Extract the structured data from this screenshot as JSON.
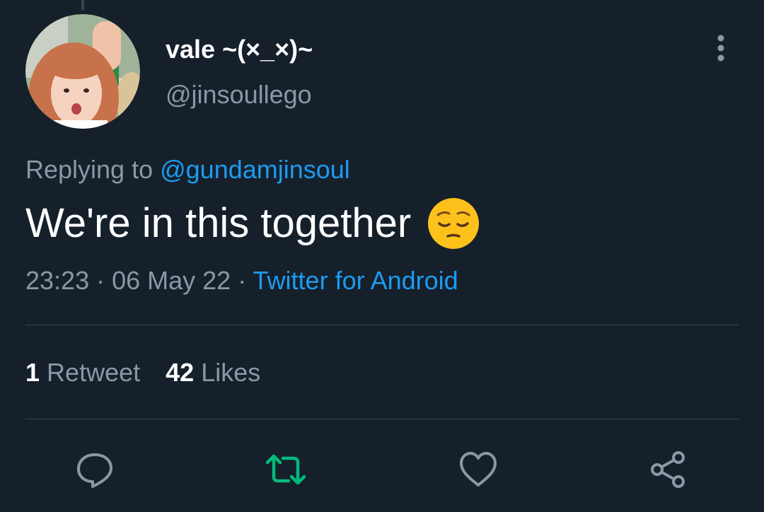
{
  "author": {
    "display_name": "vale ~(×_×)~",
    "handle": "@jinsoullego"
  },
  "tweet": {
    "replying_prefix": "Replying to ",
    "replying_to": "@gundamjinsoul",
    "text": "We're in this together",
    "emoji": "pensive-face",
    "time": "23:23",
    "separator": " · ",
    "date": "06 May 22",
    "source": "Twitter for Android"
  },
  "stats": {
    "retweet_count": "1",
    "retweet_label": "Retweet",
    "like_count": "42",
    "like_label": "Likes"
  },
  "actions": {
    "reply_icon": "reply-icon",
    "retweet_icon": "retweet-icon",
    "like_icon": "heart-icon",
    "share_icon": "share-icon"
  },
  "colors": {
    "background": "#15202b",
    "primary_text": "#ffffff",
    "secondary_text": "#8899a6",
    "link": "#1d9bf0",
    "retweet_green": "#00ba7c",
    "divider": "#38444d"
  }
}
